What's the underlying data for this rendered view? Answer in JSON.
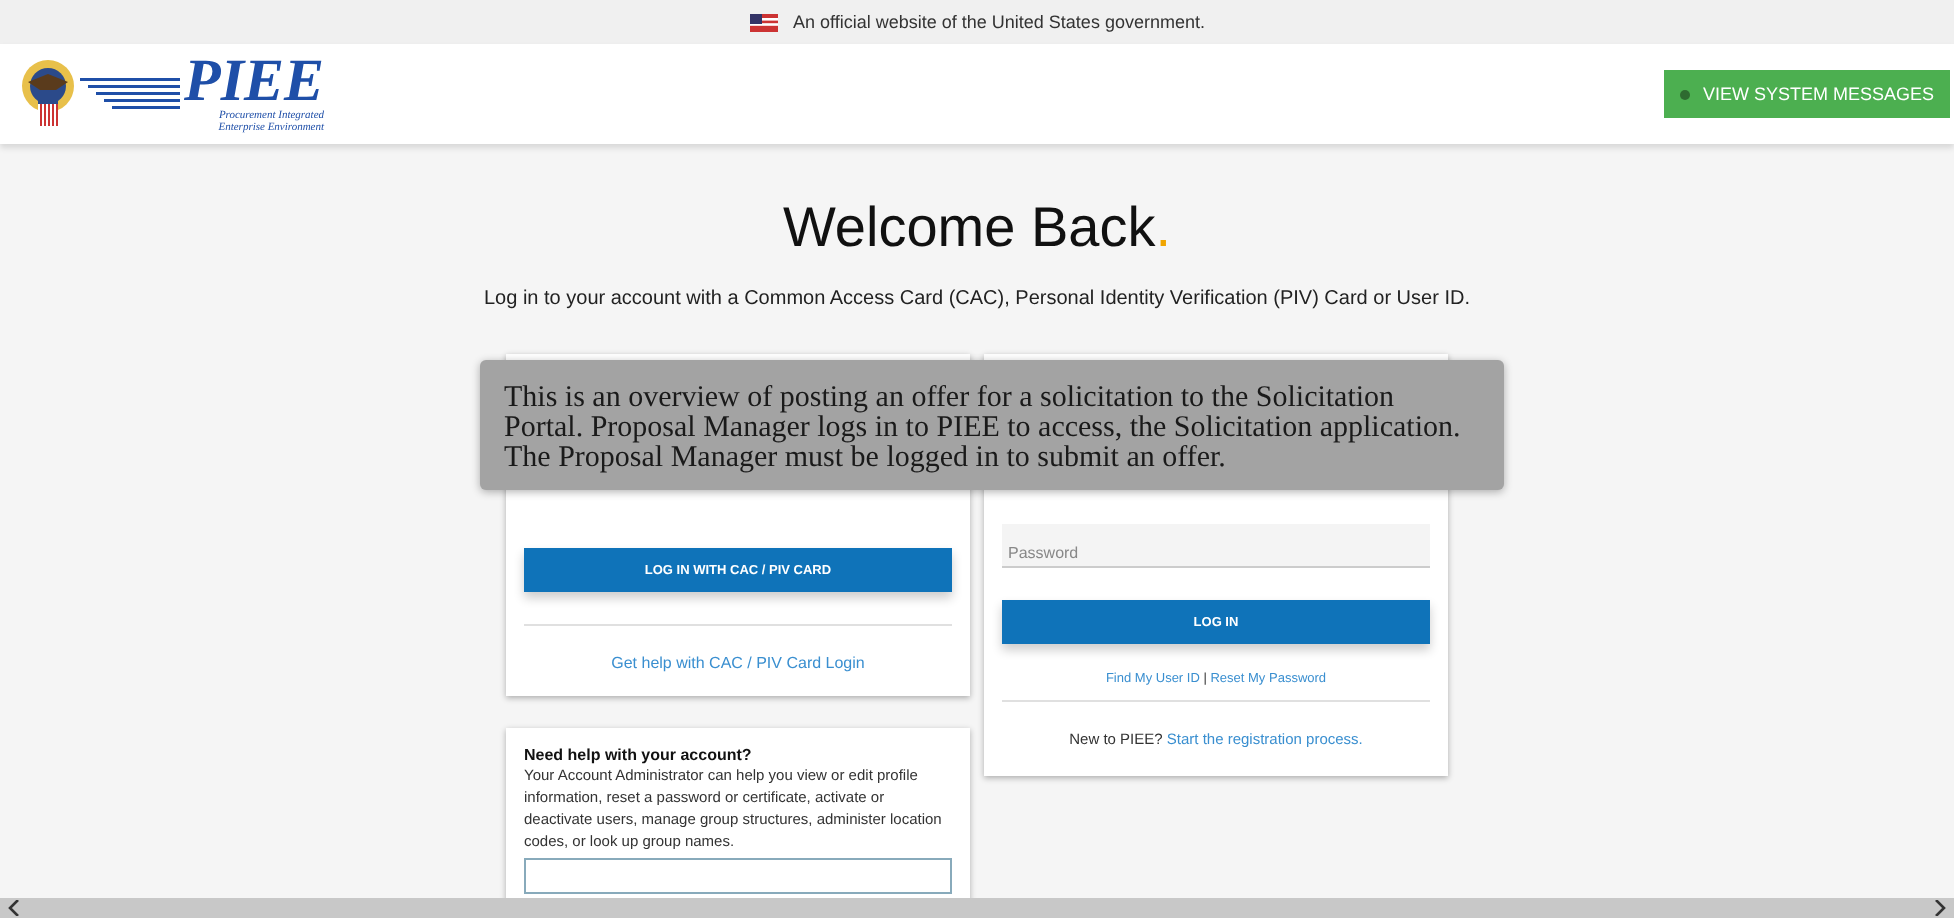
{
  "gov_banner": {
    "text": "An official website of the United States government."
  },
  "header": {
    "logo": {
      "name": "PIEE",
      "subtitle_lines": [
        "Procurement Integrated",
        "Enterprise Environment"
      ]
    },
    "messages_button": {
      "label": "VIEW SYSTEM MESSAGES"
    }
  },
  "welcome": {
    "title": "Welcome Back",
    "title_mark": ".",
    "subtitle": "Log in to your account with a Common Access Card (CAC), Personal Identity Verification (PIV) Card or User ID."
  },
  "overlay_note": {
    "text": "This is an overview of posting an offer for a solicitation to the Solicitation Portal. Proposal Manager logs in to PIEE to access, the Solicitation application. The Proposal Manager must be logged in to submit an offer."
  },
  "cac_card": {
    "button": "LOG IN WITH CAC / PIV CARD",
    "help_link": "Get help with CAC / PIV Card Login"
  },
  "user_card": {
    "password": {
      "placeholder": "Password"
    },
    "button": "LOG IN",
    "links": [
      "Find My User ID",
      "Reset My Password"
    ],
    "separator": "|",
    "register_prompt": "New to PIEE?",
    "register_link": "Start the registration process."
  },
  "account_help": {
    "heading": "Need help with your account?",
    "body": "Your Account Administrator can help you view or edit profile information, reset a password or certificate, activate or deactivate users, manage group structures, administer location codes, or look up group names."
  }
}
